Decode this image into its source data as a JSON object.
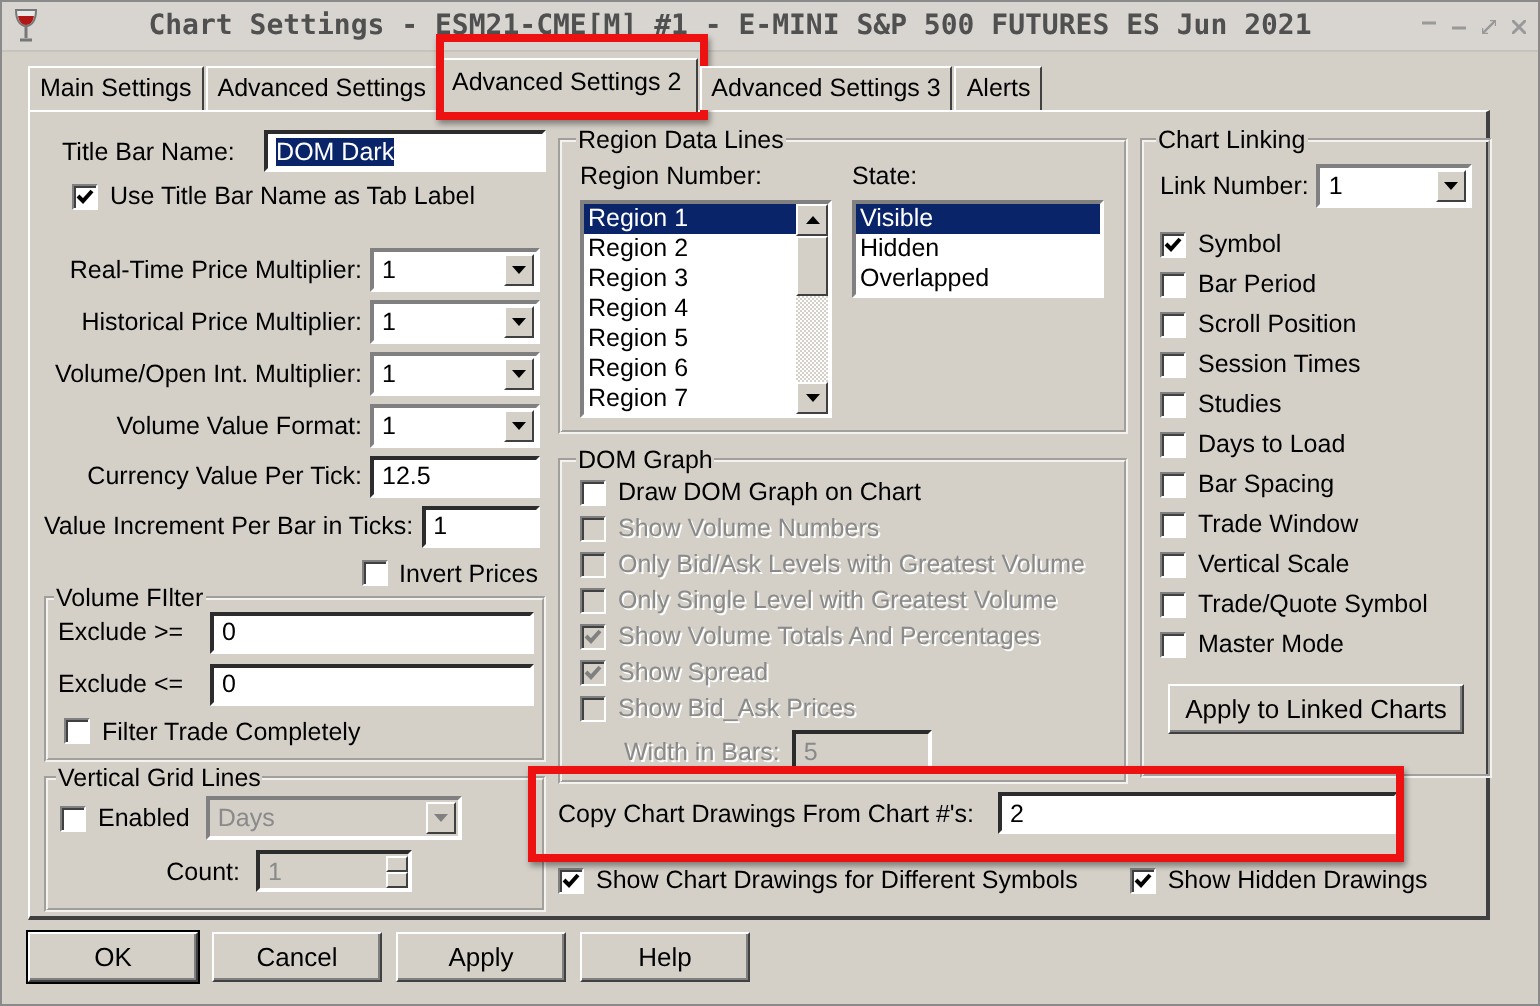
{
  "window": {
    "title": "Chart Settings - ESM21-CME[M]  #1 - E-MINI S&P 500 FUTURES ES Jun 2021"
  },
  "tabs": [
    {
      "label": "Main Settings",
      "selected": false,
      "highlighted": false
    },
    {
      "label": "Advanced Settings",
      "selected": false,
      "highlighted": false
    },
    {
      "label": "Advanced Settings 2",
      "selected": true,
      "highlighted": true
    },
    {
      "label": "Advanced Settings 3",
      "selected": false,
      "highlighted": false
    },
    {
      "label": "Alerts",
      "selected": false,
      "highlighted": false
    }
  ],
  "title_bar_name": {
    "label": "Title Bar Name:",
    "value": "DOM Dark",
    "text_selected": true
  },
  "use_title_as_tab": {
    "label": "Use Title Bar Name as Tab Label",
    "checked": true
  },
  "left_fields": [
    {
      "kind": "dropdown",
      "label": "Real-Time Price Multiplier:",
      "value": "1"
    },
    {
      "kind": "dropdown",
      "label": "Historical Price Multiplier:",
      "value": "1"
    },
    {
      "kind": "dropdown",
      "label": "Volume/Open Int. Multiplier:",
      "value": "1"
    },
    {
      "kind": "dropdown",
      "label": "Volume Value Format:",
      "value": "1"
    },
    {
      "kind": "field",
      "label": "Currency Value Per Tick:",
      "value": "12.5"
    },
    {
      "kind": "field",
      "label": "Value Increment Per Bar in Ticks:",
      "value": "1"
    }
  ],
  "invert_prices": {
    "label": "Invert Prices",
    "checked": false
  },
  "volume_filter": {
    "title": "Volume FIlter",
    "fields": [
      {
        "label": "Exclude >=",
        "value": "0"
      },
      {
        "label": "Exclude <=",
        "value": "0"
      }
    ],
    "filter_trade": {
      "label": "Filter Trade Completely",
      "checked": false
    }
  },
  "vertical_grid_lines": {
    "title": "Vertical Grid Lines",
    "enabled": {
      "label": "Enabled",
      "checked": false
    },
    "unit": {
      "value": "Days",
      "disabled": true
    },
    "count": {
      "label": "Count:",
      "value": "1",
      "disabled": true
    }
  },
  "region_data_lines": {
    "title": "Region Data Lines",
    "region_number": {
      "label": "Region Number:",
      "items": [
        {
          "label": "Region 1",
          "selected": true
        },
        {
          "label": "Region 2",
          "selected": false
        },
        {
          "label": "Region 3",
          "selected": false
        },
        {
          "label": "Region 4",
          "selected": false
        },
        {
          "label": "Region 5",
          "selected": false
        },
        {
          "label": "Region 6",
          "selected": false
        },
        {
          "label": "Region 7",
          "selected": false
        }
      ]
    },
    "state": {
      "label": "State:",
      "items": [
        {
          "label": "Visible",
          "selected": true
        },
        {
          "label": "Hidden",
          "selected": false
        },
        {
          "label": "Overlapped",
          "selected": false
        }
      ]
    }
  },
  "dom_graph": {
    "title": "DOM Graph",
    "options": [
      {
        "label": "Draw DOM Graph on Chart",
        "checked": false,
        "disabled": false
      },
      {
        "label": "Show Volume Numbers",
        "checked": false,
        "disabled": true
      },
      {
        "label": "Only Bid/Ask Levels with Greatest Volume",
        "checked": false,
        "disabled": true
      },
      {
        "label": "Only Single Level with Greatest Volume",
        "checked": false,
        "disabled": true
      },
      {
        "label": "Show Volume Totals And Percentages",
        "checked": true,
        "disabled": true
      },
      {
        "label": "Show Spread",
        "checked": true,
        "disabled": true
      },
      {
        "label": "Show Bid_Ask Prices",
        "checked": false,
        "disabled": true
      }
    ],
    "width_in_bars": {
      "label": "Width in Bars:",
      "value": "5",
      "disabled": true
    }
  },
  "chart_linking": {
    "title": "Chart Linking",
    "link_number": {
      "label": "Link Number:",
      "value": "1"
    },
    "options": [
      {
        "label": "Symbol",
        "checked": true
      },
      {
        "label": "Bar Period",
        "checked": false
      },
      {
        "label": "Scroll Position",
        "checked": false
      },
      {
        "label": "Session Times",
        "checked": false
      },
      {
        "label": "Studies",
        "checked": false
      },
      {
        "label": "Days to Load",
        "checked": false
      },
      {
        "label": "Bar Spacing",
        "checked": false
      },
      {
        "label": "Trade Window",
        "checked": false
      },
      {
        "label": "Vertical Scale",
        "checked": false
      },
      {
        "label": "Trade/Quote Symbol",
        "checked": false
      },
      {
        "label": "Master Mode",
        "checked": false
      }
    ],
    "apply_button": "Apply to Linked Charts"
  },
  "copy_drawings": {
    "label": "Copy Chart Drawings From Chart #'s:",
    "value": "2",
    "highlighted": true
  },
  "bottom_options": [
    {
      "label": "Show Chart Drawings for Different Symbols",
      "checked": true
    },
    {
      "label": "Show Hidden Drawings",
      "checked": true
    }
  ],
  "buttons": [
    {
      "label": "OK",
      "default": true
    },
    {
      "label": "Cancel",
      "default": false
    },
    {
      "label": "Apply",
      "default": false
    },
    {
      "label": "Help",
      "default": false
    }
  ]
}
